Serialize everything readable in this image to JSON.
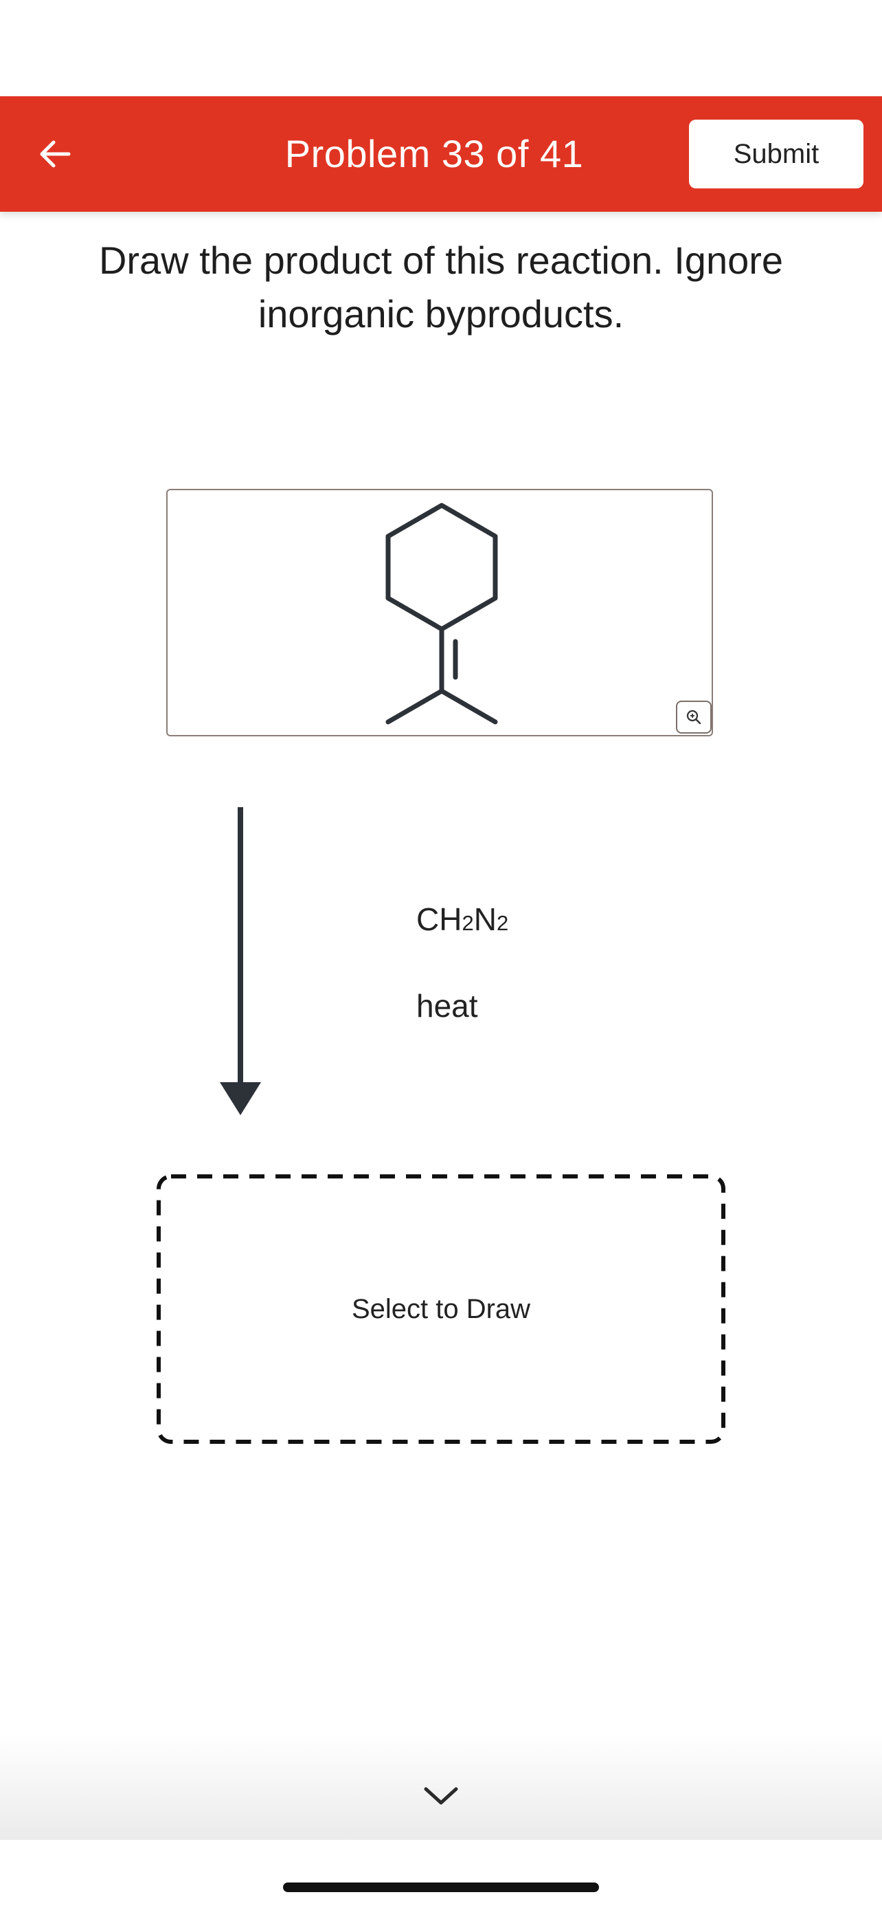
{
  "header": {
    "title": "Problem 33 of 41",
    "submit_label": "Submit",
    "back_icon": "arrow-left-icon",
    "background_color": "#e03423"
  },
  "question": {
    "text": "Draw the product of this reaction. Ignore inorganic byproducts."
  },
  "reactant": {
    "zoom_icon": "zoom-in-icon"
  },
  "reaction": {
    "reagent_1": {
      "prefix": "CH",
      "sub_1": "2",
      "mid": "N",
      "sub_2": "2"
    },
    "reagent_2": "heat"
  },
  "answer": {
    "placeholder": "Select to Draw"
  },
  "footer": {
    "chevron_icon": "chevron-down-icon"
  }
}
